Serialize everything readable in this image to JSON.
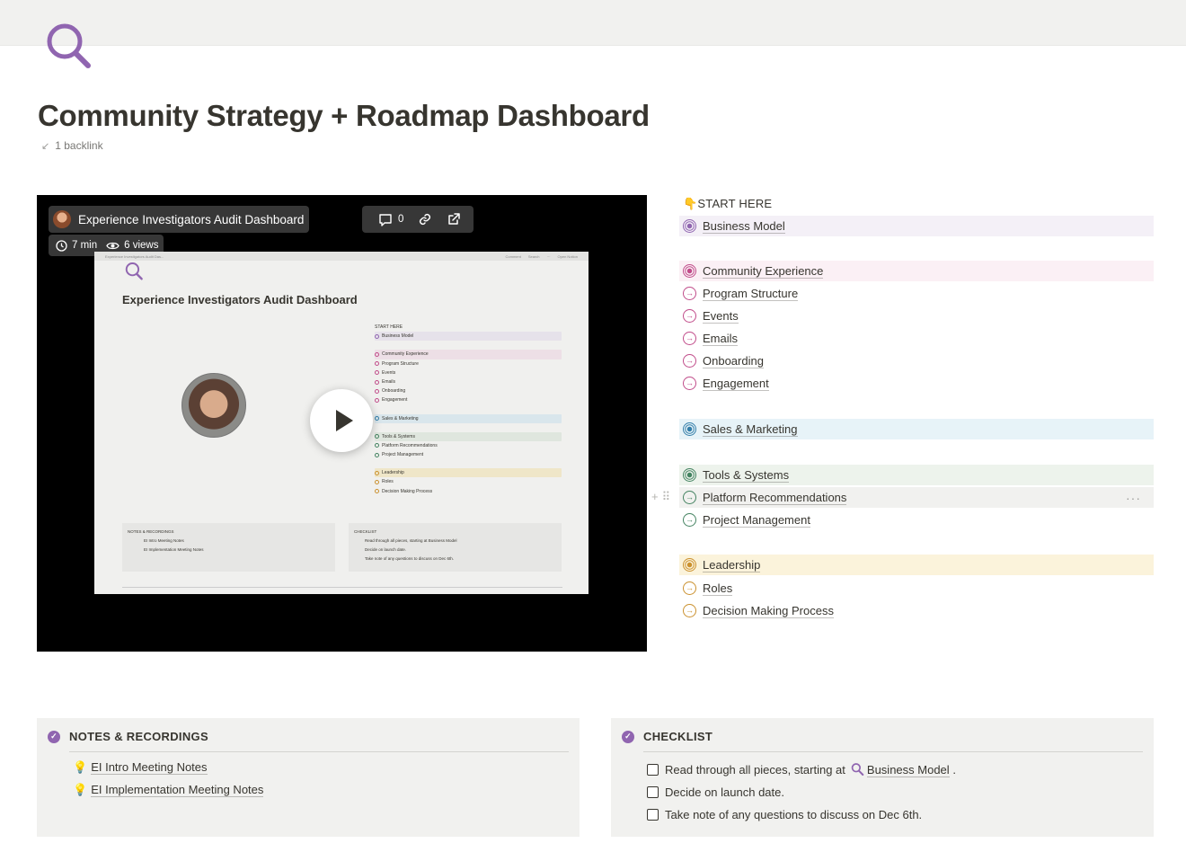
{
  "page": {
    "title": "Community Strategy + Roadmap Dashboard",
    "backlink": "1 backlink",
    "icon": "magnifier-icon"
  },
  "video": {
    "title": "Experience Investigators Audit Dashboard",
    "comments": "0",
    "duration": "7 min",
    "views": "6 views",
    "inner_title": "Experience Investigators Audit Dashboard",
    "inner_topbar_left": "Experience Investigators Audit Das...",
    "inner_topbar_right": [
      "Comment",
      "Search",
      "···",
      "Open Notion"
    ],
    "inner_items": [
      "START HERE",
      "Business Model",
      "",
      "Community Experience",
      "Program Structure",
      "Events",
      "Emails",
      "Onboarding",
      "Engagement",
      "",
      "Sales & Marketing",
      "",
      "Tools & Systems",
      "Platform Recommendations",
      "Project Management",
      "",
      "Leadership",
      "Roles",
      "Decision Making Process"
    ],
    "inner_notes": [
      "NOTES & RECORDINGS",
      "EI Intro Meeting Notes",
      "EI Implementation Meeting Notes"
    ],
    "inner_checklist": [
      "CHECKLIST",
      "Read through all pieces, starting at Business Model",
      "Decide on launch date.",
      "Take note of any questions to discuss on Dec 6th."
    ]
  },
  "index": {
    "start_label": "START HERE",
    "start_icon": "👇",
    "items": [
      {
        "label": "Business Model",
        "type": "head",
        "color": "#9065b0",
        "bg": "#f4f0f7"
      },
      {
        "label": "Community Experience",
        "type": "head",
        "color": "#c14c8a",
        "bg": "#fbf0f5"
      },
      {
        "label": "Program Structure",
        "type": "sub",
        "color": "#c14c8a"
      },
      {
        "label": "Events",
        "type": "sub",
        "color": "#c14c8a"
      },
      {
        "label": "Emails",
        "type": "sub",
        "color": "#c14c8a"
      },
      {
        "label": "Onboarding",
        "type": "sub",
        "color": "#c14c8a"
      },
      {
        "label": "Engagement",
        "type": "sub",
        "color": "#c14c8a"
      },
      {
        "label": "Sales & Marketing",
        "type": "head",
        "color": "#337ea9",
        "bg": "#e7f3f8"
      },
      {
        "label": "Tools & Systems",
        "type": "head",
        "color": "#448361",
        "bg": "#edf3ec"
      },
      {
        "label": "Platform Recommendations",
        "type": "sub",
        "color": "#448361",
        "bg": "#f1f1ef"
      },
      {
        "label": "Project Management",
        "type": "sub",
        "color": "#448361"
      },
      {
        "label": "Leadership",
        "type": "head",
        "color": "#cb912f",
        "bg": "#fbf3db"
      },
      {
        "label": "Roles",
        "type": "sub",
        "color": "#cb912f"
      },
      {
        "label": "Decision Making Process",
        "type": "sub",
        "color": "#cb912f"
      }
    ]
  },
  "notes": {
    "heading": "NOTES & RECORDINGS",
    "items": [
      "EI Intro Meeting Notes",
      "EI Implementation Meeting Notes"
    ],
    "item_icon": "💡"
  },
  "checklist": {
    "heading": "CHECKLIST",
    "items": [
      {
        "text": "Read through all pieces, starting at",
        "link": "Business Model",
        "suffix": "."
      },
      {
        "text": "Decide on launch date."
      },
      {
        "text": "Take note of any questions to discuss on Dec 6th."
      }
    ]
  },
  "colors": {
    "accent_purple": "#9065b0",
    "text": "#37352f",
    "callout_bg": "#f1f1ef"
  }
}
